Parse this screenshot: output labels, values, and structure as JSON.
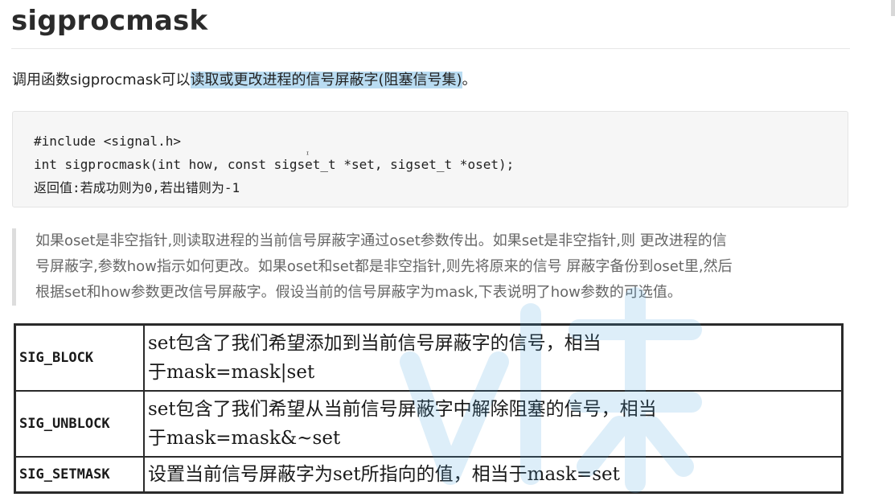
{
  "heading": "sigprocmask",
  "intro": {
    "before": "调用函数sigprocmask可以",
    "highlight": "读取或更改进程的信号屏蔽字(阻塞信号集)",
    "after": "。"
  },
  "code": {
    "line1": "#include <signal.h>",
    "line2": "int sigprocmask(int how, const sigset_t *set, sigset_t *oset);",
    "line3": "返回值:若成功则为0,若出错则为-1"
  },
  "quote": {
    "line1": "如果oset是非空指针,则读取进程的当前信号屏蔽字通过oset参数传出。如果set是非空指针,则 更改进程的信",
    "line2": "号屏蔽字,参数how指示如何更改。如果oset和set都是非空指针,则先将原来的信号 屏蔽字备份到oset里,然后",
    "line3": "根据set和how参数更改信号屏蔽字。假设当前的信号屏蔽字为mask,下表说明了how参数的可选值。"
  },
  "how_table": {
    "rows": [
      {
        "name": "SIG_BLOCK",
        "desc_line1": "set包含了我们希望添加到当前信号屏蔽字的信号，相当",
        "desc_line2": "于mask=mask|set"
      },
      {
        "name": "SIG_UNBLOCK",
        "desc_line1": "set包含了我们希望从当前信号屏蔽字中解除阻塞的信号，相当",
        "desc_line2": "于mask=mask&~set"
      },
      {
        "name": "SIG_SETMASK",
        "desc_line1": "设置当前信号屏蔽字为set所指向的值，相当于mask=set"
      }
    ]
  },
  "colors": {
    "highlight": "#b9dcf2",
    "code_background": "#f6f6f6",
    "quote_border": "#dddddd",
    "watermark": "#4aa3df"
  }
}
